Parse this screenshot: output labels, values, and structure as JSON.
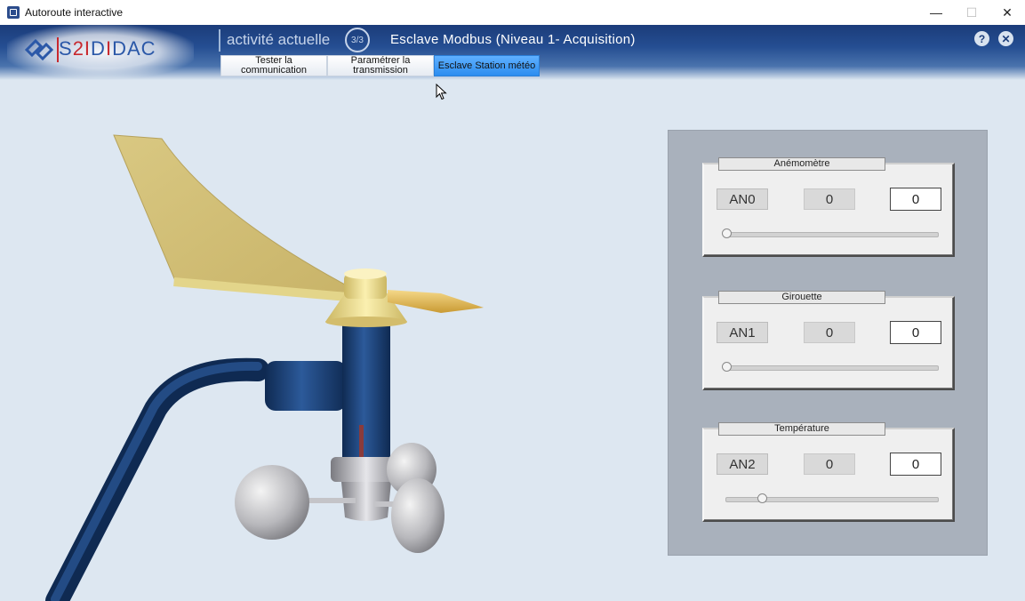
{
  "window": {
    "title": "Autoroute interactive",
    "minimize": "—",
    "maximize": "☐",
    "close": "✕"
  },
  "header": {
    "logo": {
      "part1": "S",
      "part2": "2I",
      "part3": "D",
      "part4": "I",
      "part5": "DAC"
    },
    "activity_label": "activité actuelle",
    "step": "3/3",
    "activity_title": "Esclave Modbus (Niveau 1- Acquisition)",
    "help": "?",
    "close": "✕",
    "tabs": [
      {
        "label": "Tester la communication",
        "state": "inactive"
      },
      {
        "label": "Paramétrer la transmission",
        "state": "inactive"
      },
      {
        "label": "Esclave Station météo",
        "state": "active"
      }
    ]
  },
  "channels": [
    {
      "title": "Anémomètre",
      "channel": "AN0",
      "readout": "0",
      "value": "0",
      "slider_fraction": 0.0
    },
    {
      "title": "Girouette",
      "channel": "AN1",
      "readout": "0",
      "value": "0",
      "slider_fraction": 0.0
    },
    {
      "title": "Température",
      "channel": "AN2",
      "readout": "0",
      "value": "0",
      "slider_fraction": 0.17
    }
  ],
  "colors": {
    "header_dark": "#1b3c7a",
    "active_tab": "#2b8df0",
    "vane_yellow": "#e3d58a",
    "mast_blue": "#1a3d6e",
    "panel_grey": "#a9b1bc"
  },
  "icons": {
    "app": "app-icon",
    "help": "help-icon",
    "close": "close-icon",
    "cursor": "mouse-cursor-icon"
  }
}
